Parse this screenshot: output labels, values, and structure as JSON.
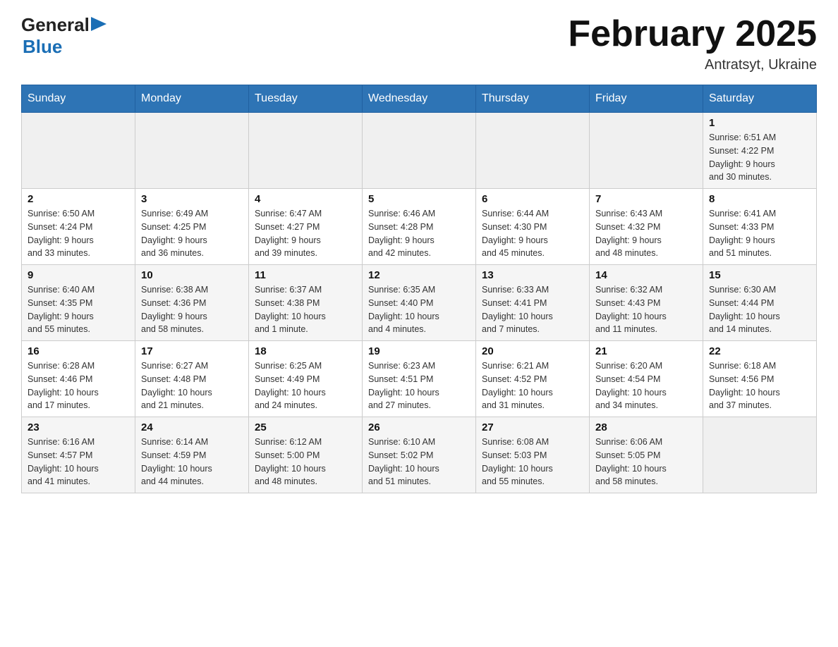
{
  "header": {
    "logo_general": "General",
    "logo_blue": "Blue",
    "month_year": "February 2025",
    "location": "Antratsyt, Ukraine"
  },
  "days_of_week": [
    "Sunday",
    "Monday",
    "Tuesday",
    "Wednesday",
    "Thursday",
    "Friday",
    "Saturday"
  ],
  "weeks": [
    {
      "days": [
        {
          "num": "",
          "info": ""
        },
        {
          "num": "",
          "info": ""
        },
        {
          "num": "",
          "info": ""
        },
        {
          "num": "",
          "info": ""
        },
        {
          "num": "",
          "info": ""
        },
        {
          "num": "",
          "info": ""
        },
        {
          "num": "1",
          "info": "Sunrise: 6:51 AM\nSunset: 4:22 PM\nDaylight: 9 hours\nand 30 minutes."
        }
      ]
    },
    {
      "days": [
        {
          "num": "2",
          "info": "Sunrise: 6:50 AM\nSunset: 4:24 PM\nDaylight: 9 hours\nand 33 minutes."
        },
        {
          "num": "3",
          "info": "Sunrise: 6:49 AM\nSunset: 4:25 PM\nDaylight: 9 hours\nand 36 minutes."
        },
        {
          "num": "4",
          "info": "Sunrise: 6:47 AM\nSunset: 4:27 PM\nDaylight: 9 hours\nand 39 minutes."
        },
        {
          "num": "5",
          "info": "Sunrise: 6:46 AM\nSunset: 4:28 PM\nDaylight: 9 hours\nand 42 minutes."
        },
        {
          "num": "6",
          "info": "Sunrise: 6:44 AM\nSunset: 4:30 PM\nDaylight: 9 hours\nand 45 minutes."
        },
        {
          "num": "7",
          "info": "Sunrise: 6:43 AM\nSunset: 4:32 PM\nDaylight: 9 hours\nand 48 minutes."
        },
        {
          "num": "8",
          "info": "Sunrise: 6:41 AM\nSunset: 4:33 PM\nDaylight: 9 hours\nand 51 minutes."
        }
      ]
    },
    {
      "days": [
        {
          "num": "9",
          "info": "Sunrise: 6:40 AM\nSunset: 4:35 PM\nDaylight: 9 hours\nand 55 minutes."
        },
        {
          "num": "10",
          "info": "Sunrise: 6:38 AM\nSunset: 4:36 PM\nDaylight: 9 hours\nand 58 minutes."
        },
        {
          "num": "11",
          "info": "Sunrise: 6:37 AM\nSunset: 4:38 PM\nDaylight: 10 hours\nand 1 minute."
        },
        {
          "num": "12",
          "info": "Sunrise: 6:35 AM\nSunset: 4:40 PM\nDaylight: 10 hours\nand 4 minutes."
        },
        {
          "num": "13",
          "info": "Sunrise: 6:33 AM\nSunset: 4:41 PM\nDaylight: 10 hours\nand 7 minutes."
        },
        {
          "num": "14",
          "info": "Sunrise: 6:32 AM\nSunset: 4:43 PM\nDaylight: 10 hours\nand 11 minutes."
        },
        {
          "num": "15",
          "info": "Sunrise: 6:30 AM\nSunset: 4:44 PM\nDaylight: 10 hours\nand 14 minutes."
        }
      ]
    },
    {
      "days": [
        {
          "num": "16",
          "info": "Sunrise: 6:28 AM\nSunset: 4:46 PM\nDaylight: 10 hours\nand 17 minutes."
        },
        {
          "num": "17",
          "info": "Sunrise: 6:27 AM\nSunset: 4:48 PM\nDaylight: 10 hours\nand 21 minutes."
        },
        {
          "num": "18",
          "info": "Sunrise: 6:25 AM\nSunset: 4:49 PM\nDaylight: 10 hours\nand 24 minutes."
        },
        {
          "num": "19",
          "info": "Sunrise: 6:23 AM\nSunset: 4:51 PM\nDaylight: 10 hours\nand 27 minutes."
        },
        {
          "num": "20",
          "info": "Sunrise: 6:21 AM\nSunset: 4:52 PM\nDaylight: 10 hours\nand 31 minutes."
        },
        {
          "num": "21",
          "info": "Sunrise: 6:20 AM\nSunset: 4:54 PM\nDaylight: 10 hours\nand 34 minutes."
        },
        {
          "num": "22",
          "info": "Sunrise: 6:18 AM\nSunset: 4:56 PM\nDaylight: 10 hours\nand 37 minutes."
        }
      ]
    },
    {
      "days": [
        {
          "num": "23",
          "info": "Sunrise: 6:16 AM\nSunset: 4:57 PM\nDaylight: 10 hours\nand 41 minutes."
        },
        {
          "num": "24",
          "info": "Sunrise: 6:14 AM\nSunset: 4:59 PM\nDaylight: 10 hours\nand 44 minutes."
        },
        {
          "num": "25",
          "info": "Sunrise: 6:12 AM\nSunset: 5:00 PM\nDaylight: 10 hours\nand 48 minutes."
        },
        {
          "num": "26",
          "info": "Sunrise: 6:10 AM\nSunset: 5:02 PM\nDaylight: 10 hours\nand 51 minutes."
        },
        {
          "num": "27",
          "info": "Sunrise: 6:08 AM\nSunset: 5:03 PM\nDaylight: 10 hours\nand 55 minutes."
        },
        {
          "num": "28",
          "info": "Sunrise: 6:06 AM\nSunset: 5:05 PM\nDaylight: 10 hours\nand 58 minutes."
        },
        {
          "num": "",
          "info": ""
        }
      ]
    }
  ]
}
